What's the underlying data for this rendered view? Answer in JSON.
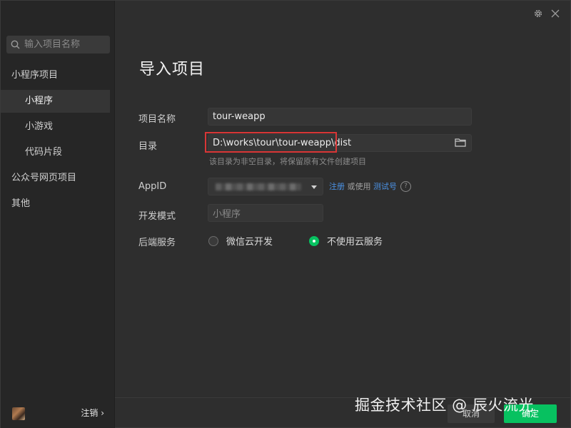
{
  "sidebar": {
    "search_placeholder": "输入项目名称",
    "items": [
      {
        "label": "小程序项目"
      },
      {
        "label": "小程序"
      },
      {
        "label": "小游戏"
      },
      {
        "label": "代码片段"
      },
      {
        "label": "公众号网页项目"
      },
      {
        "label": "其他"
      }
    ],
    "logout_label": "注销 ›"
  },
  "top_icons": [
    "gear-icon",
    "close-icon"
  ],
  "main": {
    "title": "导入项目",
    "project_name_label": "项目名称",
    "project_name_value": "tour-weapp",
    "directory_label": "目录",
    "directory_value": "D:\\works\\tour\\tour-weapp\\dist",
    "directory_hint": "该目录为非空目录，将保留原有文件创建项目",
    "appid_label": "AppID",
    "appid_register": "注册",
    "appid_or_use": " 或使用 ",
    "appid_test_account": "测试号",
    "dev_mode_label": "开发模式",
    "dev_mode_value": "小程序",
    "backend_label": "后端服务",
    "backend_options": [
      {
        "label": "微信云开发",
        "checked": false
      },
      {
        "label": "不使用云服务",
        "checked": true
      }
    ]
  },
  "footer": {
    "cancel_label": "取消",
    "ok_label": "确定"
  },
  "watermark": "掘金技术社区 @ 辰火流光",
  "colors": {
    "accent_green": "#07c160",
    "link_blue": "#4c93e6",
    "highlight_red": "#d93636"
  }
}
